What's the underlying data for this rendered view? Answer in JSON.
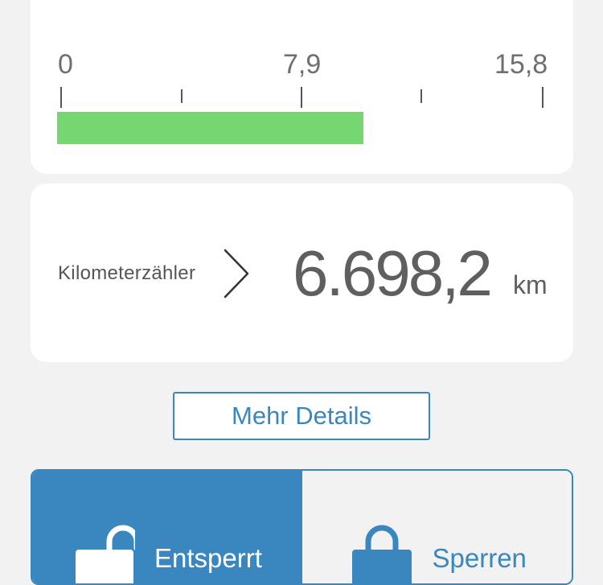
{
  "gauge": {
    "min_label": "0",
    "mid_label": "7,9",
    "max_label": "15,8",
    "fill_fraction": 0.63,
    "fill_color": "#76d672"
  },
  "odometer": {
    "label": "Kilometerzähler",
    "value": "6.698,2",
    "unit": "km",
    "chevron_icon": "chevron-right-icon"
  },
  "details_button": {
    "label": "Mehr Details"
  },
  "lock_control": {
    "unlocked_label": "Entsperrt",
    "lock_label": "Sperren",
    "unlocked_icon": "unlocked-padlock-icon",
    "lock_icon": "locked-padlock-icon",
    "active_color": "#3a87bf"
  }
}
